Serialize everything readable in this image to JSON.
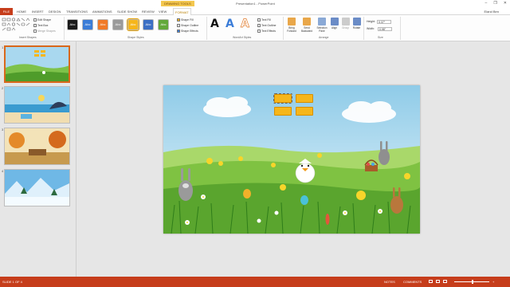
{
  "titlebar": {
    "context_tab": "DRAWING TOOLS",
    "doc_title": "Presentation1 - PowerPoint",
    "minimize": "–",
    "restore": "❐",
    "close": "✕"
  },
  "tabs": {
    "file": "FILE",
    "home": "HOME",
    "insert": "INSERT",
    "design": "DESIGN",
    "transitions": "TRANSITIONS",
    "animations": "ANIMATIONS",
    "slideshow": "SLIDE SHOW",
    "review": "REVIEW",
    "view": "VIEW",
    "format": "FORMAT",
    "user": "Eland Ben"
  },
  "ribbon": {
    "insert_shapes": {
      "edit_shape": "Edit Shape",
      "text_box": "Text Box",
      "merge_shapes": "Merge Shapes",
      "label": "Insert Shapes"
    },
    "shape_styles": {
      "swatches": [
        {
          "text": "Abc",
          "color": "#1a1a1a"
        },
        {
          "text": "Abc",
          "color": "#3b7dd8"
        },
        {
          "text": "Abc",
          "color": "#f07a28"
        },
        {
          "text": "Abc",
          "color": "#9a9a9a"
        },
        {
          "text": "Abc",
          "color": "#f6b61a"
        },
        {
          "text": "Abc",
          "color": "#3b6fc4"
        },
        {
          "text": "Abc",
          "color": "#62a83a"
        }
      ],
      "fill": "Shape Fill",
      "outline": "Shape Outline",
      "effects": "Shape Effects",
      "label": "Shape Styles"
    },
    "wordart": {
      "letters": [
        "A",
        "A",
        "A"
      ],
      "text_fill": "Text Fill",
      "text_outline": "Text Outline",
      "text_effects": "Text Effects",
      "label": "WordArt Styles"
    },
    "arrange": {
      "bring_forward": "Bring Forward",
      "send_backward": "Send Backward",
      "selection_pane": "Selection Pane",
      "align": "Align",
      "group": "Group",
      "rotate": "Rotate",
      "label": "Arrange"
    },
    "size": {
      "height_label": "Height:",
      "height_value": "0.37\"",
      "width_label": "Width:",
      "width_value": "0.98\"",
      "label": "Size"
    }
  },
  "thumbnails": [
    {
      "num": "1",
      "scene": "meadow"
    },
    {
      "num": "2",
      "scene": "beach"
    },
    {
      "num": "3",
      "scene": "autumn"
    },
    {
      "num": "4",
      "scene": "winter"
    }
  ],
  "statusbar": {
    "slide_info": "SLIDE 1 OF 4",
    "notes": "NOTES",
    "comments": "COMMENTS",
    "zoom": "+"
  }
}
